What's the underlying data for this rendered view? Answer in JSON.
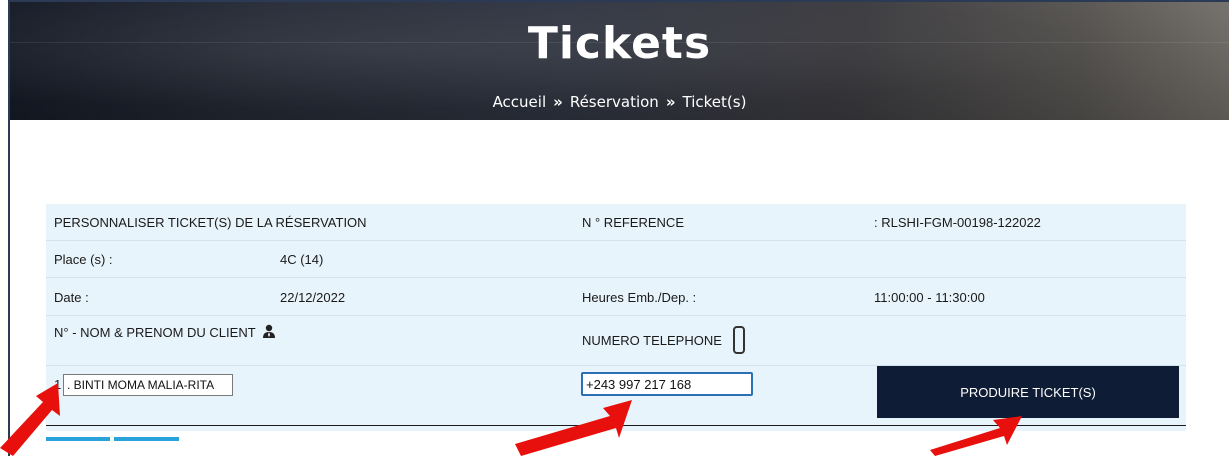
{
  "header": {
    "title": "Tickets",
    "breadcrumb": [
      {
        "label": "Accueil"
      },
      {
        "label": "Réservation"
      },
      {
        "label": "Ticket(s)"
      }
    ],
    "separator": "»"
  },
  "form": {
    "section_title": "PERSONNALISER TICKET(S) DE LA RÉSERVATION",
    "reference_label": "N ° REFERENCE",
    "reference_value": ": RLSHI-FGM-00198-122022",
    "place_label": "Place (s) :",
    "place_value": "4C (14)",
    "date_label": "Date :",
    "date_value": "22/12/2022",
    "heures_label": "Heures Emb./Dep. :",
    "heures_value": "11:00:00 - 11:30:00",
    "client_label": "N° - NOM & PRENOM DU CLIENT",
    "phone_label": "NUMERO TELEPHONE",
    "passenger_number": "1",
    "client_name_value": ". BINTI MOMA MALIA-RITA",
    "phone_value": "+243 997 217 168",
    "submit_label": "PRODUIRE TICKET(S)"
  },
  "icons": {
    "client": "user-icon",
    "phone": "phone-icon"
  },
  "colors": {
    "button": "#0e1c35",
    "panel": "#e8f4fb",
    "accent": "#29a3dc",
    "arrow": "#e8100c"
  }
}
